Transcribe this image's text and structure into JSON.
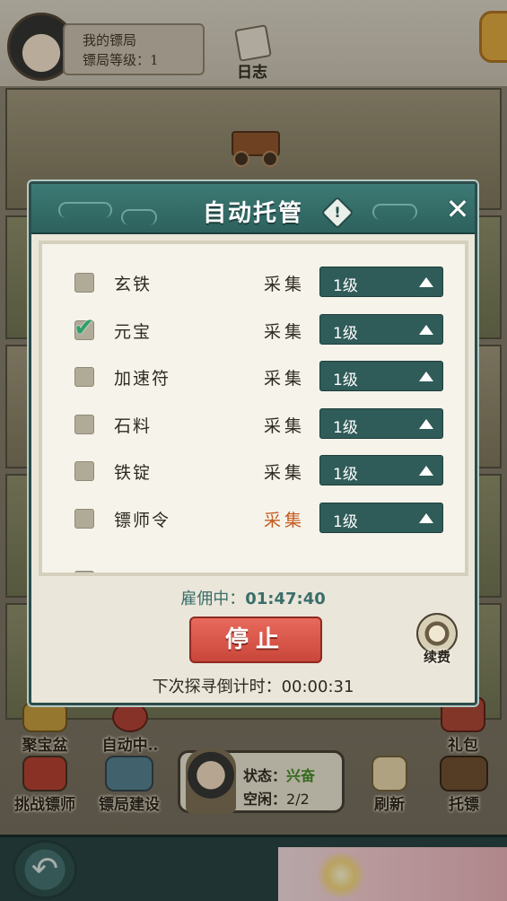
{
  "top": {
    "bureau_title": "我的镖局",
    "bureau_level": "镖局等级：1",
    "log_label": "日志"
  },
  "bottom": {
    "treasure_label": "聚宝盆",
    "auto_label": "自动中..",
    "gift_label": "礼包",
    "challenge_label": "挑战镖师",
    "build_label": "镖局建设",
    "refresh_label": "刷新",
    "escort_label": "托镖",
    "status_label": "状态：",
    "status_value": "兴奋",
    "idle_label": "空闲：",
    "idle_value": "2/2"
  },
  "modal": {
    "title": "自动托管",
    "info_icon": "!",
    "close_icon": "✕",
    "items": [
      {
        "name": "玄铁",
        "checked": false,
        "action": "采集",
        "level": "1级",
        "highlight": false
      },
      {
        "name": "元宝",
        "checked": true,
        "action": "采集",
        "level": "1级",
        "highlight": false
      },
      {
        "name": "加速符",
        "checked": false,
        "action": "采集",
        "level": "1级",
        "highlight": false
      },
      {
        "name": "石料",
        "checked": false,
        "action": "采集",
        "level": "1级",
        "highlight": false
      },
      {
        "name": "铁锭",
        "checked": false,
        "action": "采集",
        "level": "1级",
        "highlight": false
      },
      {
        "name": "镖师令",
        "checked": false,
        "action": "采集",
        "level": "1级",
        "highlight": true
      }
    ],
    "hire_label": "雇佣中：",
    "hire_time": "01:47:40",
    "stop_label": "停止",
    "renew_label": "续费",
    "next_label": "下次探寻倒计时：",
    "next_time": "00:00:31"
  },
  "colors": {
    "header_teal": "#2d615d",
    "stop_red": "#c9463a",
    "level_teal": "#2f5b58",
    "check_green": "#2fa069",
    "status_green": "#3c8a1e",
    "highlight_orange": "#c45a1e"
  }
}
